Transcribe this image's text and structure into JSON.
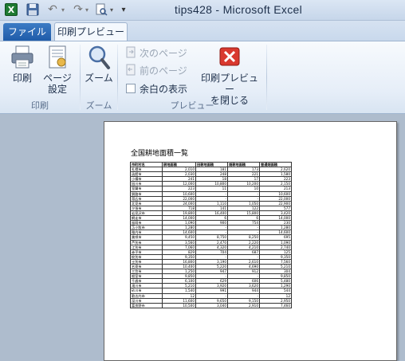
{
  "window": {
    "title": "tips428 - Microsoft Excel"
  },
  "tabs": {
    "file": "ファイル",
    "print_preview": "印刷プレビュー"
  },
  "ribbon": {
    "print": {
      "label": "印刷",
      "group_label": "印刷"
    },
    "page_setup": {
      "label_line1": "ページ",
      "label_line2": "設定"
    },
    "zoom": {
      "label": "ズーム",
      "group_label": "ズーム"
    },
    "next_page": "次のページ",
    "prev_page": "前のページ",
    "show_margins": "余白の表示",
    "close_preview": {
      "label_line1": "印刷プレビュー",
      "label_line2": "を閉じる"
    },
    "preview_group_label": "プレビュー"
  },
  "colors": {
    "file_tab": "#1e5aa8",
    "close_red": "#d9392f",
    "excel_green": "#1e7a32"
  },
  "document": {
    "title": "全国耕地面積一覧",
    "headers": [
      "市町村名",
      "耕地面積",
      "田耕地面積",
      "畑耕地面積",
      "普通畑面積"
    ],
    "rows": [
      [
        "札幌市",
        "2,010",
        "181",
        "173",
        "2,620"
      ],
      [
        "函館市",
        "2,030",
        "248",
        "221",
        "1,580"
      ],
      [
        "小樽市",
        "241",
        "18",
        "17",
        "223"
      ],
      [
        "旭川市",
        "12,000",
        "10,800",
        "10,200",
        "2,150"
      ],
      [
        "室蘭市",
        "223",
        "11",
        "10",
        "213"
      ],
      [
        "釧路市",
        "10,600",
        "-",
        "-",
        "10,600"
      ],
      [
        "帯広市",
        "22,000",
        "-",
        "-",
        "22,000"
      ],
      [
        "北見市",
        "24,000",
        "1,110",
        "1,050",
        "22,900"
      ],
      [
        "夕張市",
        "718",
        "141",
        "122",
        "577"
      ],
      [
        "岩見沢市",
        "19,800",
        "16,400",
        "15,800",
        "3,420"
      ],
      [
        "網走市",
        "14,000",
        "6",
        "6",
        "14,000"
      ],
      [
        "留萌市",
        "1,090",
        "900",
        "754",
        "230"
      ],
      [
        "苫小牧市",
        "1,280",
        "-",
        "-",
        "1,280"
      ],
      [
        "稚内市",
        "14,600",
        "-",
        "-",
        "14,600"
      ],
      [
        "美唄市",
        "9,450",
        "8,750",
        "8,250",
        "695"
      ],
      [
        "芦別市",
        "3,560",
        "2,470",
        "2,220",
        "1,090"
      ],
      [
        "江別市",
        "7,060",
        "4,320",
        "4,210",
        "2,740"
      ],
      [
        "赤平市",
        "829",
        "704",
        "687",
        "125"
      ],
      [
        "紋別市",
        "9,350",
        "-",
        "-",
        "9,350"
      ],
      [
        "士別市",
        "16,800",
        "3,190",
        "2,610",
        "7,560"
      ],
      [
        "名寄市",
        "10,400",
        "5,220",
        "4,690",
        "5,210"
      ],
      [
        "三笠市",
        "1,250",
        "947",
        "912",
        "304"
      ],
      [
        "根室市",
        "9,850",
        "-",
        "-",
        "9,850"
      ],
      [
        "千歳市",
        "6,100",
        "629",
        "606",
        "5,480"
      ],
      [
        "滝川市",
        "5,210",
        "3,920",
        "3,620",
        "1,290"
      ],
      [
        "砂川市",
        "1,540",
        "991",
        "944",
        "544"
      ],
      [
        "歌志内市",
        "12",
        "-",
        "-",
        "12"
      ],
      [
        "深川市",
        "11,600",
        "9,650",
        "9,150",
        "2,950"
      ],
      [
        "富良野市",
        "10,500",
        "3,040",
        "2,910",
        "7,460"
      ]
    ]
  }
}
